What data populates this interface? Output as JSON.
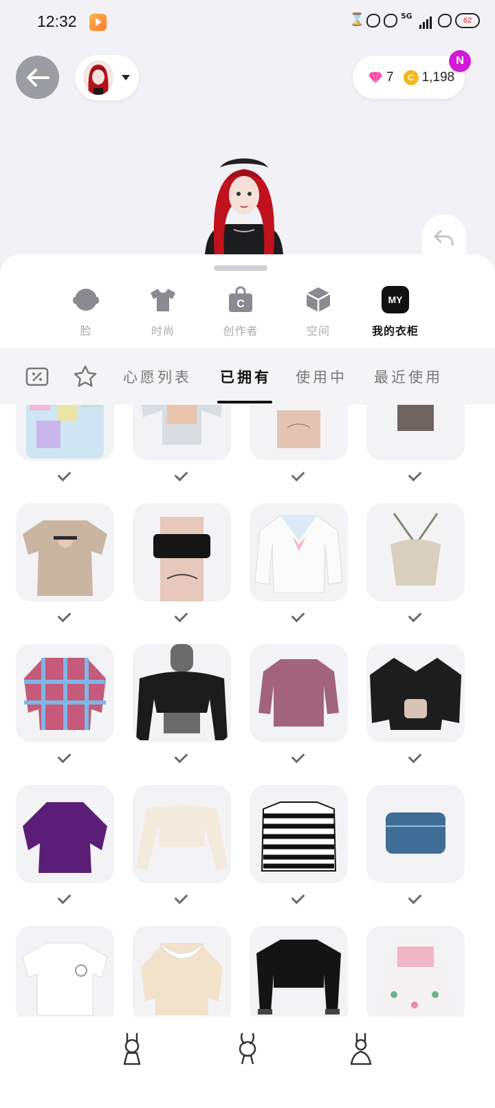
{
  "status_bar": {
    "time": "12:32",
    "network": "5G",
    "battery": "62"
  },
  "header": {
    "gems": "7",
    "coins": "1,198",
    "coin_symbol": "C",
    "notification_badge": "N"
  },
  "categories": [
    {
      "label": "脸",
      "icon": "face-icon"
    },
    {
      "label": "时尚",
      "icon": "tshirt-icon"
    },
    {
      "label": "创作者",
      "icon": "creator-bag-icon"
    },
    {
      "label": "空间",
      "icon": "space-cube-icon"
    },
    {
      "label": "我的衣柜",
      "icon": "my-closet-icon",
      "icon_text": "MY",
      "active": true
    }
  ],
  "tabs": [
    {
      "label": "心愿列表"
    },
    {
      "label": "已拥有",
      "active": true
    },
    {
      "label": "使用中"
    },
    {
      "label": "最近使用"
    }
  ],
  "items": [
    {
      "name": "pastel-patchwork-jacket",
      "owned": true
    },
    {
      "name": "grey-shrug-top",
      "owned": true
    },
    {
      "name": "white-crop-top-tattoo",
      "owned": true
    },
    {
      "name": "white-ruffle-collar-top",
      "owned": true
    },
    {
      "name": "beige-keyhole-tee",
      "owned": true
    },
    {
      "name": "black-tube-top-tattoos",
      "owned": true
    },
    {
      "name": "white-sailor-sweater",
      "owned": true
    },
    {
      "name": "beige-lace-halter",
      "owned": true
    },
    {
      "name": "plaid-flannel-shirt",
      "owned": true
    },
    {
      "name": "black-off-shoulder-top",
      "owned": true
    },
    {
      "name": "mauve-sweater",
      "owned": true
    },
    {
      "name": "black-bear-cardigan",
      "owned": true
    },
    {
      "name": "purple-velvet-blouse",
      "owned": true
    },
    {
      "name": "cream-off-shoulder-top",
      "owned": true
    },
    {
      "name": "striped-tee",
      "owned": true
    },
    {
      "name": "denim-tube-top",
      "owned": true
    },
    {
      "name": "white-graphic-tee",
      "owned": true
    },
    {
      "name": "cream-lace-collar-blouse",
      "owned": true
    },
    {
      "name": "black-feather-crop-jacket",
      "owned": true
    },
    {
      "name": "floral-dress-pink-corset",
      "owned": true
    }
  ],
  "colors": {
    "accent": "#111111",
    "badge": "#d21bd8",
    "coin": "#f3b922",
    "gem": "#ff3fa4"
  }
}
